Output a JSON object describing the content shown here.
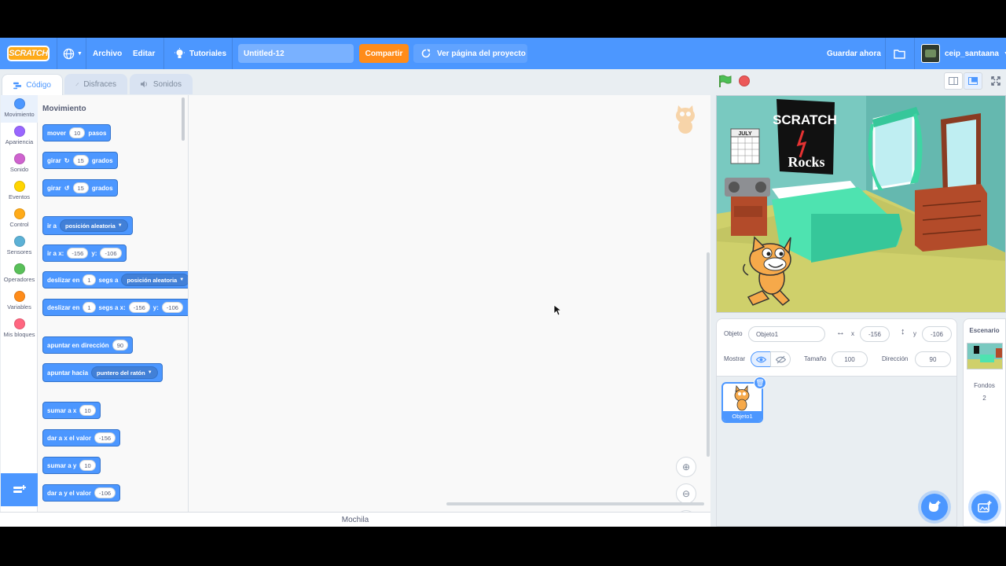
{
  "menubar": {
    "logo": "SCRATCH",
    "file": "Archivo",
    "edit": "Editar",
    "tutorials": "Tutoriales",
    "project_title": "Untitled-12",
    "share": "Compartir",
    "see_project_page": "Ver página del proyecto",
    "save_now": "Guardar ahora",
    "username": "ceip_santaana"
  },
  "tabs": {
    "code": "Código",
    "costumes": "Disfraces",
    "sounds": "Sonidos"
  },
  "categories": [
    {
      "label": "Movimiento",
      "color": "#4c97ff"
    },
    {
      "label": "Apariencia",
      "color": "#9966ff"
    },
    {
      "label": "Sonido",
      "color": "#cf63cf"
    },
    {
      "label": "Eventos",
      "color": "#ffd500"
    },
    {
      "label": "Control",
      "color": "#ffab19"
    },
    {
      "label": "Sensores",
      "color": "#5cb1d6"
    },
    {
      "label": "Operadores",
      "color": "#59c059"
    },
    {
      "label": "Variables",
      "color": "#ff8c1a"
    },
    {
      "label": "Mis bloques",
      "color": "#ff6680"
    }
  ],
  "palette": {
    "section": "Movimiento",
    "move": {
      "a": "mover",
      "v": "10",
      "b": "pasos"
    },
    "turn_right": {
      "a": "girar",
      "v": "15",
      "b": "grados"
    },
    "turn_left": {
      "a": "girar",
      "v": "15",
      "b": "grados"
    },
    "goto": {
      "a": "ir a",
      "d": "posición aleatoria"
    },
    "goto_xy": {
      "a": "ir a x:",
      "x": "-156",
      "b": "y:",
      "y": "-106"
    },
    "glide": {
      "a": "deslizar en",
      "v": "1",
      "b": "segs a",
      "d": "posición aleatoria"
    },
    "glide_xy": {
      "a": "deslizar en",
      "v": "1",
      "b": "segs a x:",
      "x": "-156",
      "c": "y:",
      "y": "-106"
    },
    "point_dir": {
      "a": "apuntar en dirección",
      "v": "90"
    },
    "point_towards": {
      "a": "apuntar hacia",
      "d": "puntero del ratón"
    },
    "change_x": {
      "a": "sumar a x",
      "v": "10"
    },
    "set_x": {
      "a": "dar a x el valor",
      "v": "-156"
    },
    "change_y": {
      "a": "sumar a y",
      "v": "10"
    },
    "set_y": {
      "a": "dar a y el valor",
      "v": "-106"
    }
  },
  "backpack": "Mochila",
  "sprite_info": {
    "sprite_label": "Objeto",
    "sprite_name": "Objeto1",
    "x_label": "x",
    "x_value": "-156",
    "y_label": "y",
    "y_value": "-106",
    "show_label": "Mostrar",
    "size_label": "Tamaño",
    "size_value": "100",
    "direction_label": "Dirección",
    "direction_value": "90"
  },
  "sprite_tile": "Objeto1",
  "backdrop": {
    "title": "Escenario",
    "label": "Fondos",
    "count": "2"
  },
  "stage_poster": {
    "line1": "SCRATCH",
    "line2": "Rocks",
    "calendar": "JULY"
  }
}
